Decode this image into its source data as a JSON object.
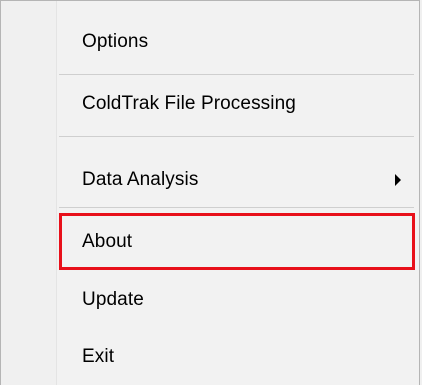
{
  "menu": {
    "items": [
      {
        "label": "Options"
      },
      {
        "label": "ColdTrak File Processing"
      },
      {
        "label": "Data Analysis",
        "submenu_icon": "chevron-right-icon"
      },
      {
        "label": "About"
      },
      {
        "label": "Update"
      },
      {
        "label": "Exit"
      }
    ]
  },
  "colors": {
    "menu_background": "#f2f2f2",
    "separator": "#cfcfcf",
    "highlight_border": "#e8101a"
  }
}
